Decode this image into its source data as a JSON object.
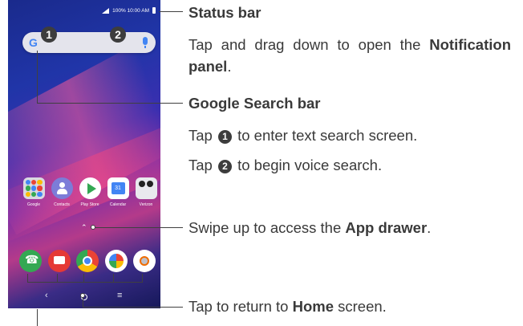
{
  "phone": {
    "status_text": "100%  10:00 AM",
    "search_icon_letter": "G",
    "callout_1": "1",
    "callout_2": "2",
    "apps": [
      {
        "label": "Google",
        "icon": "folder"
      },
      {
        "label": "Contacts",
        "icon": "contacts"
      },
      {
        "label": "Play Store",
        "icon": "play-store"
      },
      {
        "label": "Calendar",
        "icon": "calendar",
        "day": "31"
      },
      {
        "label": "Verizon",
        "icon": "verizon"
      }
    ],
    "dock": [
      {
        "icon": "phone-call"
      },
      {
        "icon": "messages"
      },
      {
        "icon": "chrome"
      },
      {
        "icon": "photos"
      },
      {
        "icon": "camera"
      }
    ],
    "nav": {
      "back": "‹",
      "recents": "≡"
    }
  },
  "annotations": {
    "status_bar_title": "Status bar",
    "status_bar_desc_a": "Tap and drag down to open the",
    "status_bar_desc_b": "Notification panel",
    "status_bar_desc_c": ".",
    "search_title": "Google Search bar",
    "search_tap1_pre": "Tap",
    "search_tap1_num": "1",
    "search_tap1_post": "to enter text search screen.",
    "search_tap2_pre": "Tap",
    "search_tap2_num": "2",
    "search_tap2_post": "to begin voice search.",
    "swipe_a": "Swipe up to access the",
    "swipe_b": "App drawer",
    "swipe_c": ".",
    "home_a": "Tap to return to",
    "home_b": "Home",
    "home_c": "screen."
  }
}
